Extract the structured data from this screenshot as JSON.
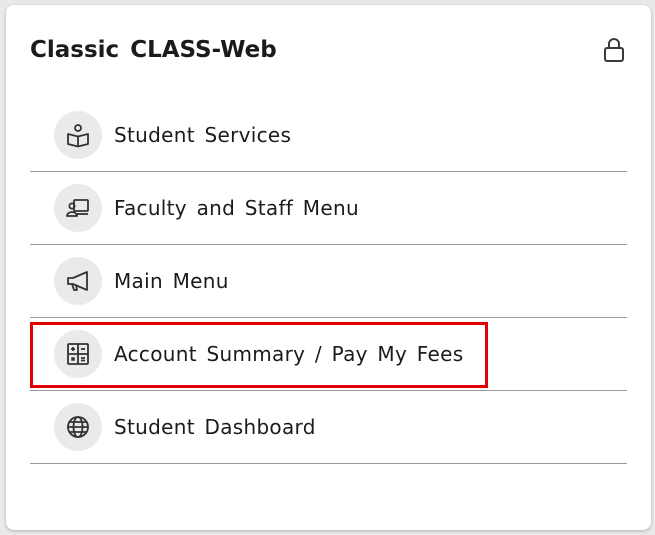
{
  "card": {
    "title": "Classic CLASS-Web",
    "lock_icon": "lock-icon"
  },
  "menu": {
    "items": [
      {
        "label": "Student Services",
        "icon": "book-reader-icon"
      },
      {
        "label": "Faculty and Staff Menu",
        "icon": "presenter-board-icon"
      },
      {
        "label": "Main Menu",
        "icon": "megaphone-icon"
      },
      {
        "label": "Account Summary / Pay My Fees",
        "icon": "calculator-icon"
      },
      {
        "label": "Student Dashboard",
        "icon": "globe-icon"
      }
    ]
  },
  "colors": {
    "highlight": "#e00000",
    "icon_background": "#eaeaea",
    "text": "#1b1b1b",
    "divider": "#9a9a9a"
  }
}
